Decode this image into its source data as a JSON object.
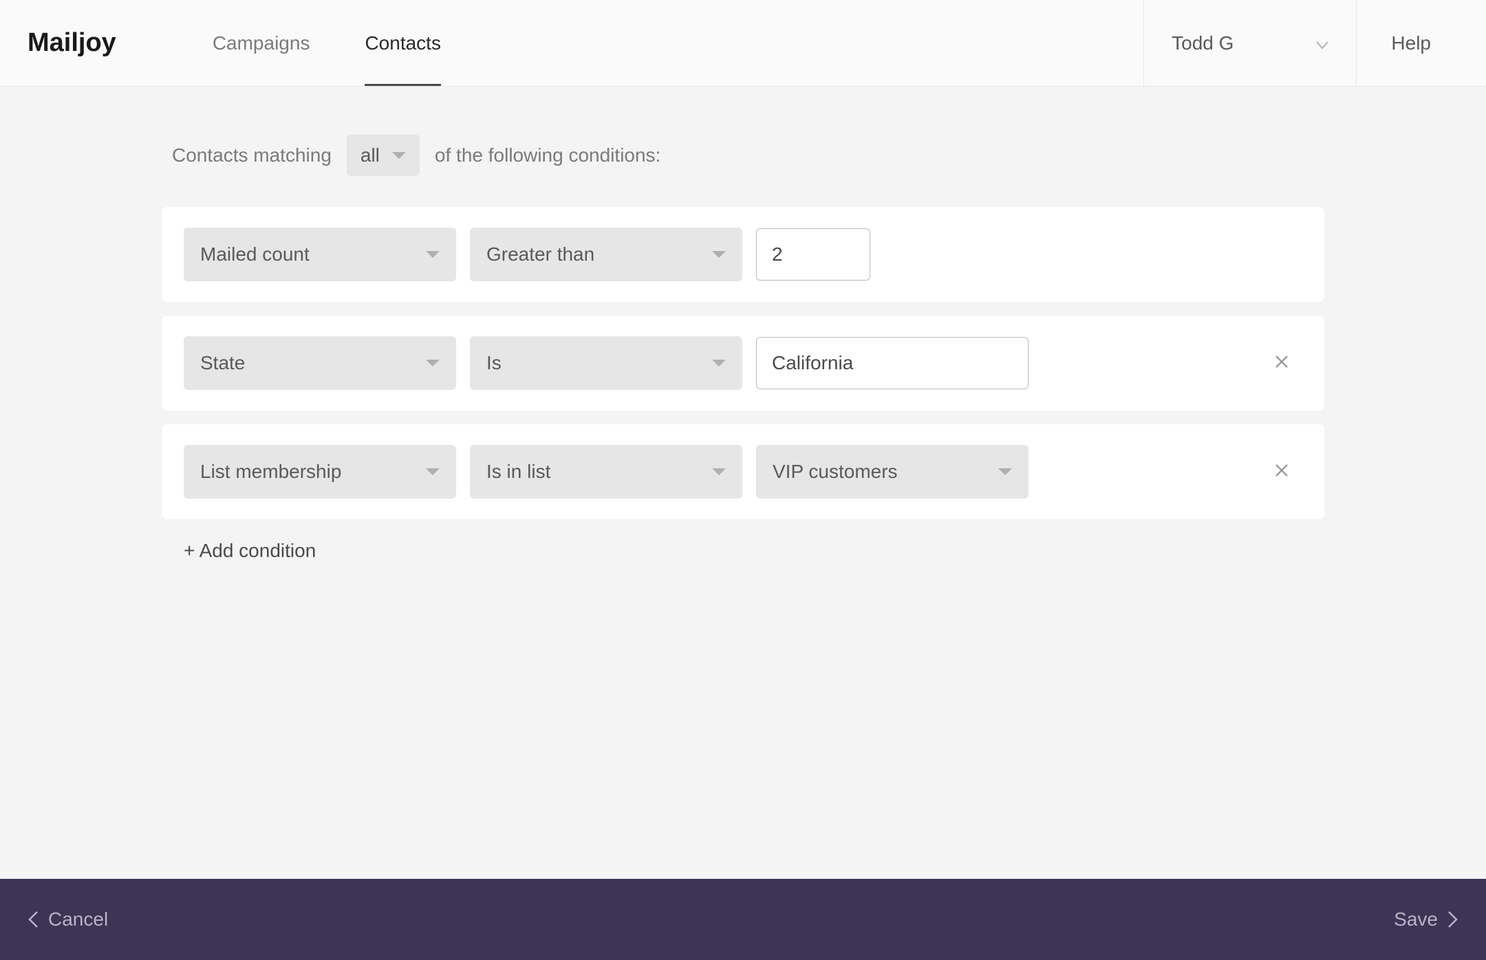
{
  "brand": "Mailjoy",
  "nav": {
    "campaigns": "Campaigns",
    "contacts": "Contacts"
  },
  "user": {
    "name": "Todd G"
  },
  "help": "Help",
  "filter": {
    "prefix": "Contacts matching",
    "match": "all",
    "suffix": "of the following conditions:"
  },
  "conditions": [
    {
      "field": "Mailed count",
      "operator": "Greater than",
      "value": "2",
      "value_type": "input_narrow",
      "removable": false
    },
    {
      "field": "State",
      "operator": "Is",
      "value": "California",
      "value_type": "input_wide",
      "removable": true
    },
    {
      "field": "List membership",
      "operator": "Is in list",
      "value": "VIP customers",
      "value_type": "dropdown",
      "removable": true
    }
  ],
  "add_condition": "+ Add condition",
  "footer": {
    "cancel": "Cancel",
    "save": "Save"
  }
}
